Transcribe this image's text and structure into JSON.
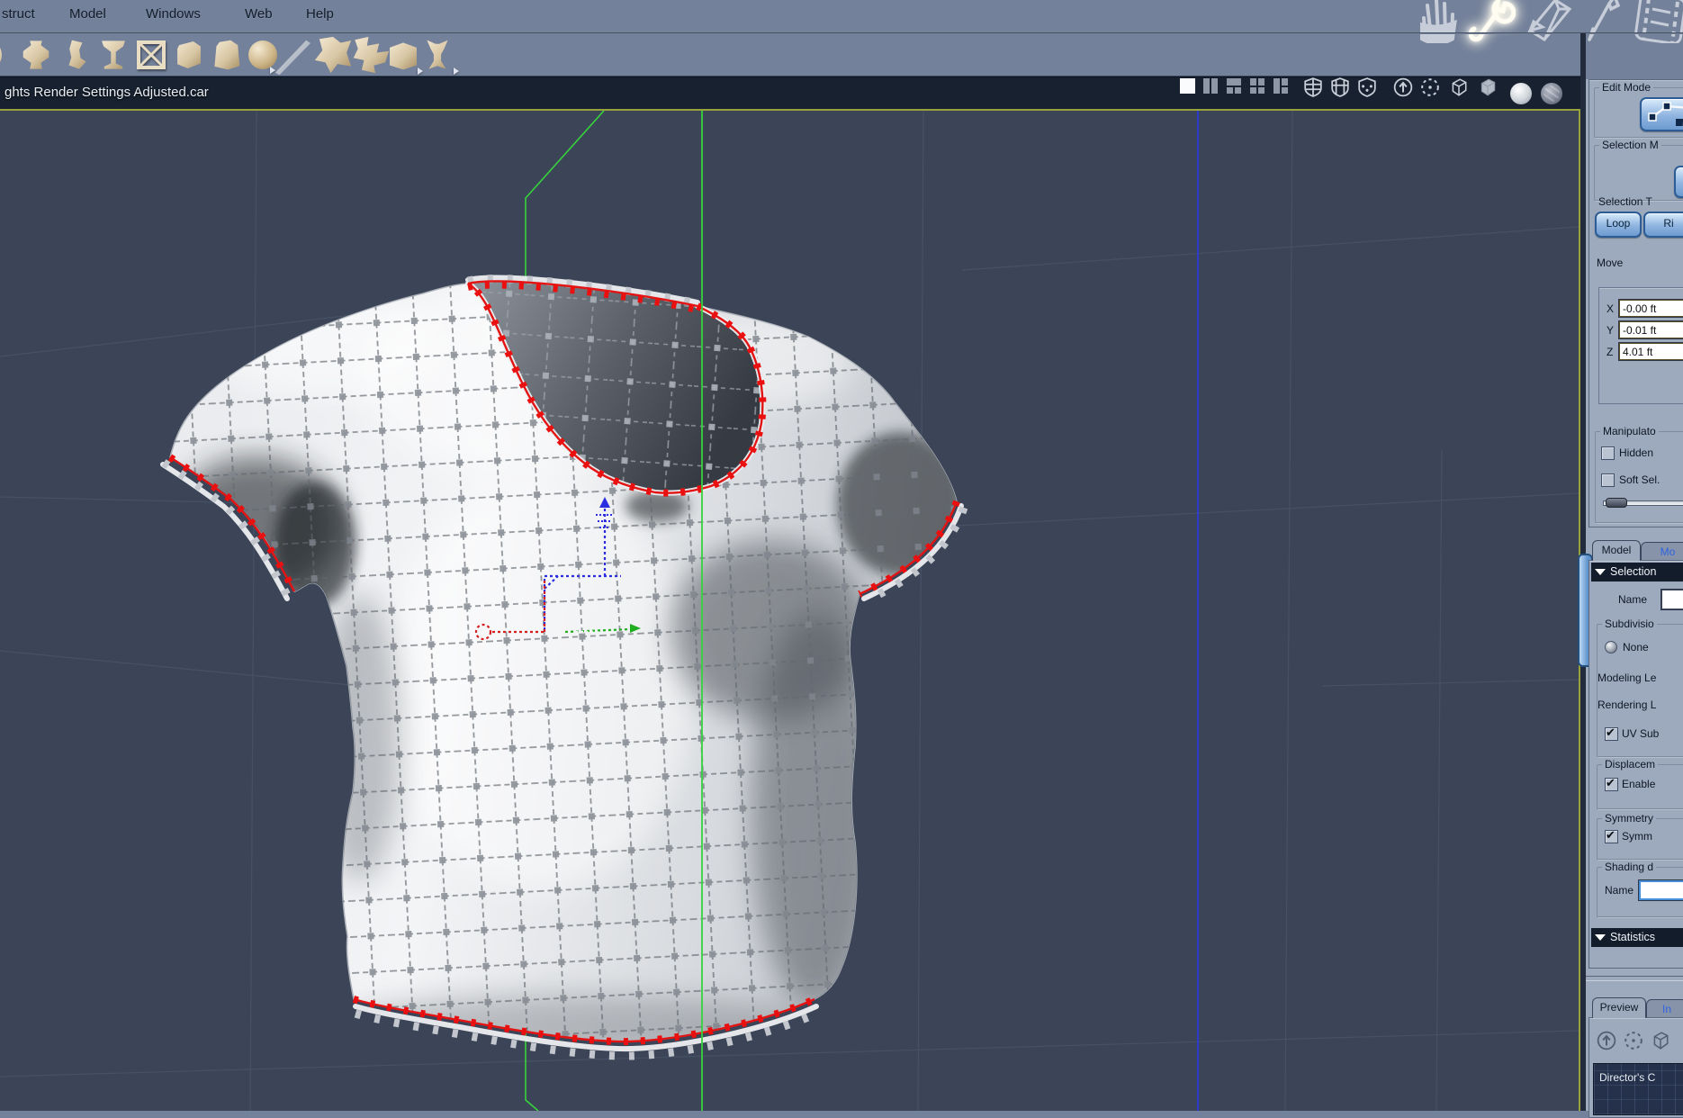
{
  "menu": {
    "items": [
      "struct",
      "Model",
      "Windows",
      "Web",
      "Help"
    ]
  },
  "rooms": {
    "icons": [
      "hand-icon",
      "wrench-icon",
      "model-room-icon",
      "texture-pen-icon",
      "film-icon"
    ],
    "active": "wrench-icon"
  },
  "toolbar": {
    "icons": [
      "dome",
      "lathe",
      "bend-shape",
      "goblet",
      "delete-box",
      "cube",
      "bag",
      "sphere",
      "pen-line",
      "deform-a",
      "deform-b",
      "tool-chest",
      "shear"
    ]
  },
  "titlebar": {
    "filename": "ghts Render Settings Adjusted.car",
    "layout_icons": [
      "single-pane",
      "two-pane",
      "three-pane",
      "four-pane",
      "l-pane"
    ],
    "shield_icons": [
      "shield-wire",
      "shield-grid",
      "shield-dots"
    ],
    "display_icons": [
      "normals-arrow",
      "rotate-free",
      "wireframe-cube",
      "flat-cube",
      "smooth-sphere",
      "textured-sphere"
    ]
  },
  "viewport": {
    "content": "t-shirt polygon mesh with selected edge loops",
    "selection_color": "#e81414",
    "axis_green": "#38d23c",
    "axis_blue": "#2b3ad8",
    "background": "#3b4557"
  },
  "panel": {
    "edit_mode_label": "Edit Mode",
    "selection_mode_label": "Selection M",
    "selection_tools_label": "Selection T",
    "loop_button": "Loop",
    "ring_button": "Ri",
    "move_label": "Move",
    "move": {
      "x_label": "X",
      "x_value": "-0.00 ft",
      "y_label": "Y",
      "y_value": "-0.01 ft",
      "z_label": "Z",
      "z_value": "4.01 ft"
    },
    "manipulators_label": "Manipulato",
    "hidden": {
      "label": "Hidden",
      "checked": false
    },
    "soft_sel": {
      "label": "Soft Sel.",
      "checked": false
    },
    "tabs": {
      "model": "Model",
      "morph": "Mo"
    },
    "selection_header": "Selection",
    "name_label": "Name",
    "name_value": "",
    "subdivision_label": "Subdivisio",
    "none_label": "None",
    "modeling_level_label": "Modeling Le",
    "rendering_level_label": "Rendering L",
    "uv_sub": {
      "label": "UV Sub",
      "checked": true
    },
    "displacement_label": "Displacem",
    "enable": {
      "label": "Enable",
      "checked": true
    },
    "symmetry_label": "Symmetry",
    "symm": {
      "label": "Symm",
      "checked": true
    },
    "shading_label": "Shading d",
    "shading_name_label": "Name",
    "shading_name_value": "",
    "statistics_header": "Statistics",
    "preview_tabs": {
      "preview": "Preview",
      "interactive": "In"
    },
    "camera_label": "Director's C"
  }
}
